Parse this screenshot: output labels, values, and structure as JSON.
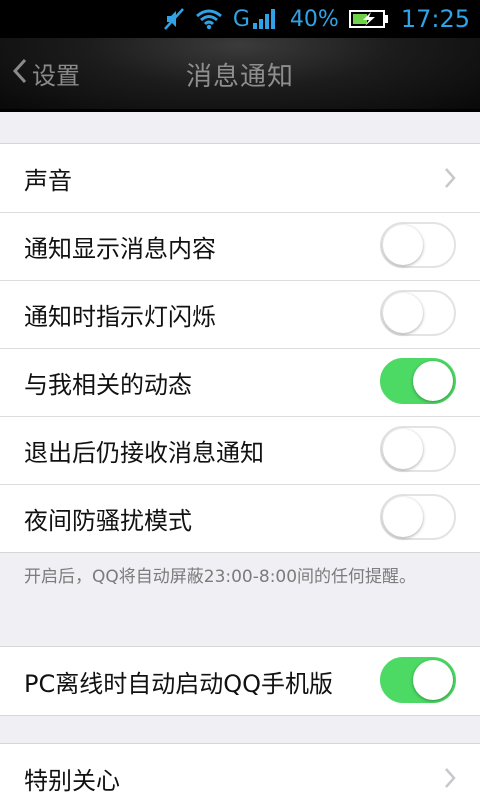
{
  "status_bar": {
    "battery_percent": "40%",
    "network_type": "G",
    "time": "17:25",
    "icons": [
      "mute-icon",
      "wifi-icon",
      "signal-icon",
      "battery-charging-icon"
    ],
    "accent_color": "#2fa3e6"
  },
  "header": {
    "back_label": "设置",
    "title": "消息通知"
  },
  "group1": {
    "items": [
      {
        "label": "声音",
        "type": "link"
      },
      {
        "label": "通知显示消息内容",
        "type": "toggle",
        "on": false
      },
      {
        "label": "通知时指示灯闪烁",
        "type": "toggle",
        "on": false
      },
      {
        "label": "与我相关的动态",
        "type": "toggle",
        "on": true
      },
      {
        "label": "退出后仍接收消息通知",
        "type": "toggle",
        "on": false
      },
      {
        "label": "夜间防骚扰模式",
        "type": "toggle",
        "on": false
      }
    ]
  },
  "footnote": "开启后，QQ将自动屏蔽23:00-8:00间的任何提醒。",
  "group2": {
    "items": [
      {
        "label": "PC离线时自动启动QQ手机版",
        "type": "toggle",
        "on": true
      }
    ]
  },
  "group3": {
    "items": [
      {
        "label": "特别关心",
        "type": "link"
      }
    ]
  },
  "colors": {
    "toggle_on": "#4cd964",
    "background": "#efeff4"
  }
}
